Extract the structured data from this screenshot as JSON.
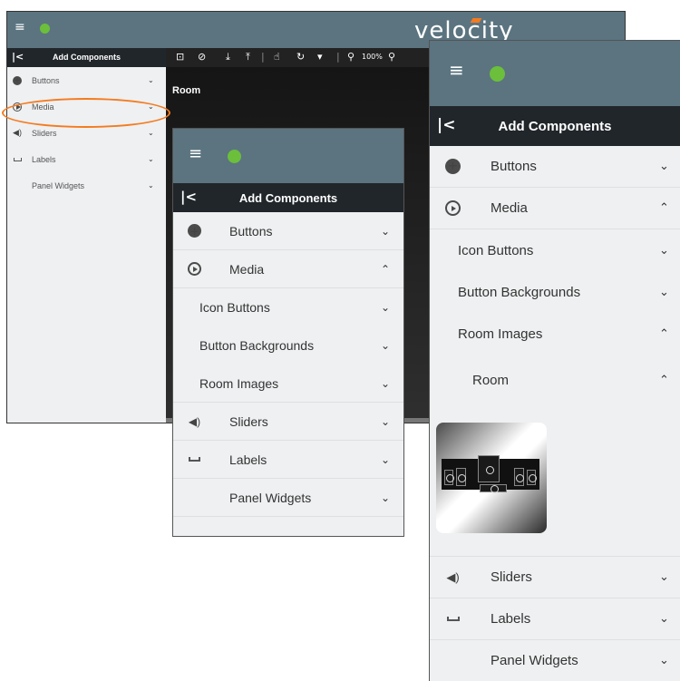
{
  "brand": {
    "logo": "velocity",
    "accent": "#f47b20",
    "header_color": "#5b7480",
    "dark_bar": "#21262b",
    "globe_color": "#6bbf3b"
  },
  "editor": {
    "panel_title": "Add Components",
    "canvas_title": "Room",
    "zoom": "100%",
    "items": [
      {
        "label": "Buttons",
        "icon": "add-circle-icon"
      },
      {
        "label": "Media",
        "icon": "play-circle-icon"
      },
      {
        "label": "Sliders",
        "icon": "volume-icon"
      },
      {
        "label": "Labels",
        "icon": "label-icon"
      },
      {
        "label": "Panel Widgets",
        "icon": "widgets-icon"
      }
    ],
    "toolbar_icons": [
      "aspect-icon",
      "block-icon",
      "download-icon",
      "upload-icon",
      "touch-icon",
      "refresh-icon",
      "clean-icon",
      "zoom-out-icon",
      "zoom-in-icon"
    ]
  },
  "mid": {
    "title": "Add Components",
    "items": [
      {
        "label": "Buttons",
        "expanded": false
      },
      {
        "label": "Media",
        "expanded": true
      },
      {
        "label": "Icon Buttons",
        "expanded": false
      },
      {
        "label": "Button Backgrounds",
        "expanded": false
      },
      {
        "label": "Room Images",
        "expanded": false
      },
      {
        "label": "Sliders",
        "expanded": false
      },
      {
        "label": "Labels",
        "expanded": false
      },
      {
        "label": "Panel Widgets",
        "expanded": false
      }
    ]
  },
  "right": {
    "title": "Add Components",
    "items": [
      {
        "label": "Buttons",
        "expanded": false
      },
      {
        "label": "Media",
        "expanded": true
      },
      {
        "label": "Icon Buttons",
        "expanded": false
      },
      {
        "label": "Button Backgrounds",
        "expanded": false
      },
      {
        "label": "Room Images",
        "expanded": true
      },
      {
        "label": "Room",
        "expanded": true
      },
      {
        "label": "Sliders",
        "expanded": false
      },
      {
        "label": "Labels",
        "expanded": false
      },
      {
        "label": "Panel Widgets",
        "expanded": false
      }
    ],
    "thumbnail": "speaker-system-room-image"
  },
  "glyphs": {
    "chevron_down": "⌄",
    "chevron_up": "⌃",
    "collapse": "|<",
    "burger": "≡"
  }
}
